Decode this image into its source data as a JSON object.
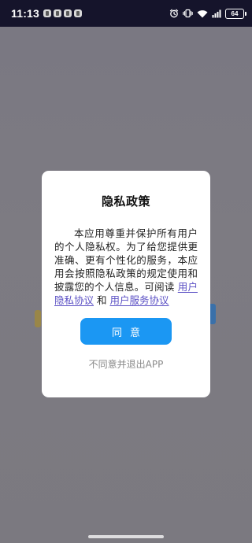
{
  "status_bar": {
    "time": "11:13",
    "notification_icons": [
      "app-notification-icon",
      "app-notification-icon",
      "app-notification-icon",
      "app-notification-icon"
    ],
    "battery_level": "64"
  },
  "dialog": {
    "title": "隐私政策",
    "body_text": "本应用尊重并保护所有用户的个人隐私权。为了给您提供更准确、更有个性化的服务，本应用会按照隐私政策的规定使用和披露您的个人信息。可阅读",
    "privacy_link": "用户隐私协议",
    "conjunction": "和",
    "service_link": "用户服务协议",
    "agree_label": "同意",
    "disagree_label": "不同意并退出APP"
  },
  "colors": {
    "accent": "#1b97f3",
    "link": "#5a4fc4",
    "status_bar_bg": "#15142b",
    "overlay_bg": "#7a7882"
  }
}
